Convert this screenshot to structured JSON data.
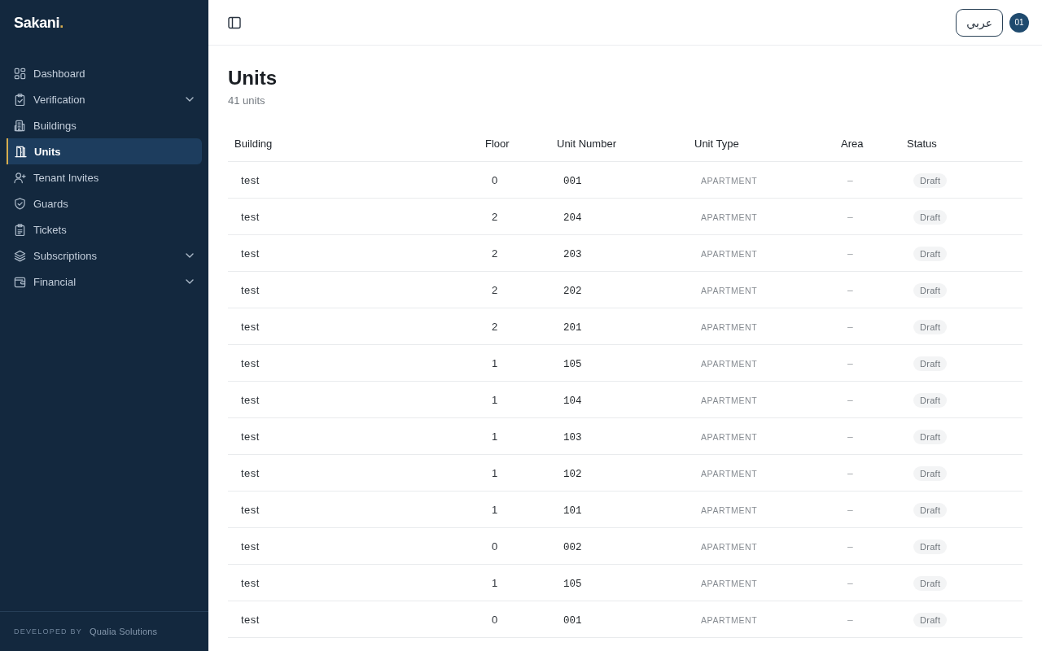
{
  "sidebar": {
    "logo": {
      "name": "Sakani",
      "dot": "."
    },
    "items": [
      {
        "label": "Dashboard",
        "kind": "link",
        "selected": false
      },
      {
        "label": "Verification",
        "kind": "group",
        "expanded": false,
        "selected": false
      },
      {
        "label": "Buildings",
        "kind": "link",
        "selected": false
      },
      {
        "label": "Units",
        "kind": "link",
        "selected": true
      },
      {
        "label": "Tenant Invites",
        "kind": "link",
        "selected": false
      },
      {
        "label": "Guards",
        "kind": "link",
        "selected": false
      },
      {
        "label": "Tickets",
        "kind": "link",
        "selected": false
      },
      {
        "label": "Subscriptions",
        "kind": "group",
        "expanded": false,
        "selected": false
      },
      {
        "label": "Financial",
        "kind": "group",
        "expanded": false,
        "selected": false
      }
    ],
    "footer": {
      "caption": "DEVELOPED BY",
      "company": "Qualia Solutions"
    }
  },
  "topbar": {
    "language_button": "عربي",
    "avatar": "01"
  },
  "page": {
    "title": "Units",
    "subtitle": "41 units"
  },
  "table": {
    "columns": [
      "Building",
      "Floor",
      "Unit Number",
      "Unit Type",
      "Area",
      "Status"
    ],
    "rows": [
      {
        "building": "test",
        "floor": "0",
        "unit_number": "001",
        "unit_type": "APARTMENT",
        "area": "–",
        "status": "Draft"
      },
      {
        "building": "test",
        "floor": "2",
        "unit_number": "204",
        "unit_type": "APARTMENT",
        "area": "–",
        "status": "Draft"
      },
      {
        "building": "test",
        "floor": "2",
        "unit_number": "203",
        "unit_type": "APARTMENT",
        "area": "–",
        "status": "Draft"
      },
      {
        "building": "test",
        "floor": "2",
        "unit_number": "202",
        "unit_type": "APARTMENT",
        "area": "–",
        "status": "Draft"
      },
      {
        "building": "test",
        "floor": "2",
        "unit_number": "201",
        "unit_type": "APARTMENT",
        "area": "–",
        "status": "Draft"
      },
      {
        "building": "test",
        "floor": "1",
        "unit_number": "105",
        "unit_type": "APARTMENT",
        "area": "–",
        "status": "Draft"
      },
      {
        "building": "test",
        "floor": "1",
        "unit_number": "104",
        "unit_type": "APARTMENT",
        "area": "–",
        "status": "Draft"
      },
      {
        "building": "test",
        "floor": "1",
        "unit_number": "103",
        "unit_type": "APARTMENT",
        "area": "–",
        "status": "Draft"
      },
      {
        "building": "test",
        "floor": "1",
        "unit_number": "102",
        "unit_type": "APARTMENT",
        "area": "–",
        "status": "Draft"
      },
      {
        "building": "test",
        "floor": "1",
        "unit_number": "101",
        "unit_type": "APARTMENT",
        "area": "–",
        "status": "Draft"
      },
      {
        "building": "test",
        "floor": "0",
        "unit_number": "002",
        "unit_type": "APARTMENT",
        "area": "–",
        "status": "Draft"
      },
      {
        "building": "test",
        "floor": "1",
        "unit_number": "105",
        "unit_type": "APARTMENT",
        "area": "–",
        "status": "Draft"
      },
      {
        "building": "test",
        "floor": "0",
        "unit_number": "001",
        "unit_type": "APARTMENT",
        "area": "–",
        "status": "Draft"
      }
    ]
  }
}
